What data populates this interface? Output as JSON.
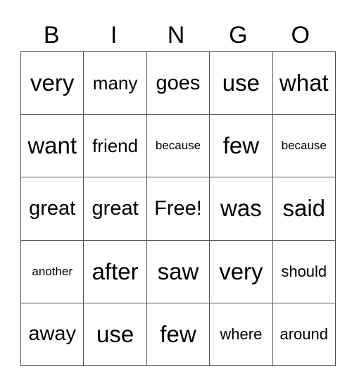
{
  "header": [
    "B",
    "I",
    "N",
    "G",
    "O"
  ],
  "rows": [
    [
      "very",
      "many",
      "goes",
      "use",
      "what"
    ],
    [
      "want",
      "friend",
      "because",
      "few",
      "because"
    ],
    [
      "great",
      "great",
      "Free!",
      "was",
      "said"
    ],
    [
      "another",
      "after",
      "saw",
      "very",
      "should"
    ],
    [
      "away",
      "use",
      "few",
      "where",
      "around"
    ]
  ]
}
